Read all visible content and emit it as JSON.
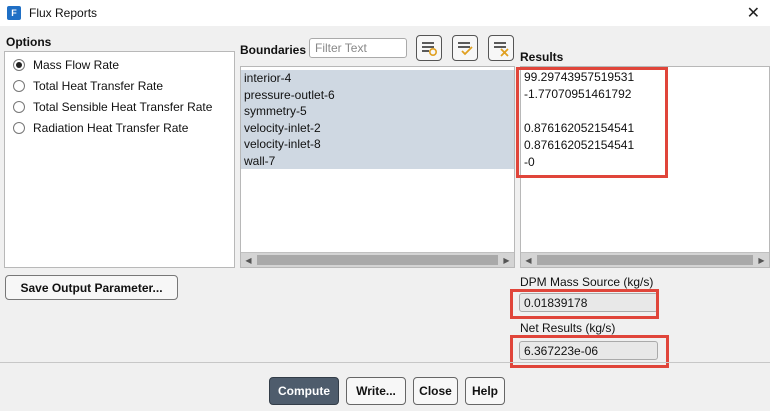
{
  "window": {
    "title": "Flux Reports",
    "app_icon_glyph": "F"
  },
  "options": {
    "label": "Options",
    "items": [
      {
        "label": "Mass Flow Rate",
        "checked": true
      },
      {
        "label": "Total Heat Transfer Rate",
        "checked": false
      },
      {
        "label": "Total Sensible Heat Transfer Rate",
        "checked": false
      },
      {
        "label": "Radiation Heat Transfer Rate",
        "checked": false
      }
    ]
  },
  "boundaries": {
    "label": "Boundaries",
    "filter_placeholder": "Filter Text",
    "items": [
      "interior-4",
      "pressure-outlet-6",
      "symmetry-5",
      "velocity-inlet-2",
      "velocity-inlet-8",
      "wall-7"
    ]
  },
  "results": {
    "label": "Results",
    "lines": [
      "99.29743957519531",
      "-1.77070951461792",
      "",
      "0.876162052154541",
      "0.876162052154541",
      "-0"
    ]
  },
  "save_button": "Save Output Parameter...",
  "dpm": {
    "label": "DPM Mass Source (kg/s)",
    "value": "0.01839178"
  },
  "net": {
    "label": "Net Results (kg/s)",
    "value": "6.367223e-06"
  },
  "footer": {
    "compute": "Compute",
    "write": "Write...",
    "close": "Close",
    "help": "Help"
  },
  "colors": {
    "highlight": "#e0453a",
    "selection": "#cfd8e2",
    "primary_button": "#4e5c6c"
  }
}
